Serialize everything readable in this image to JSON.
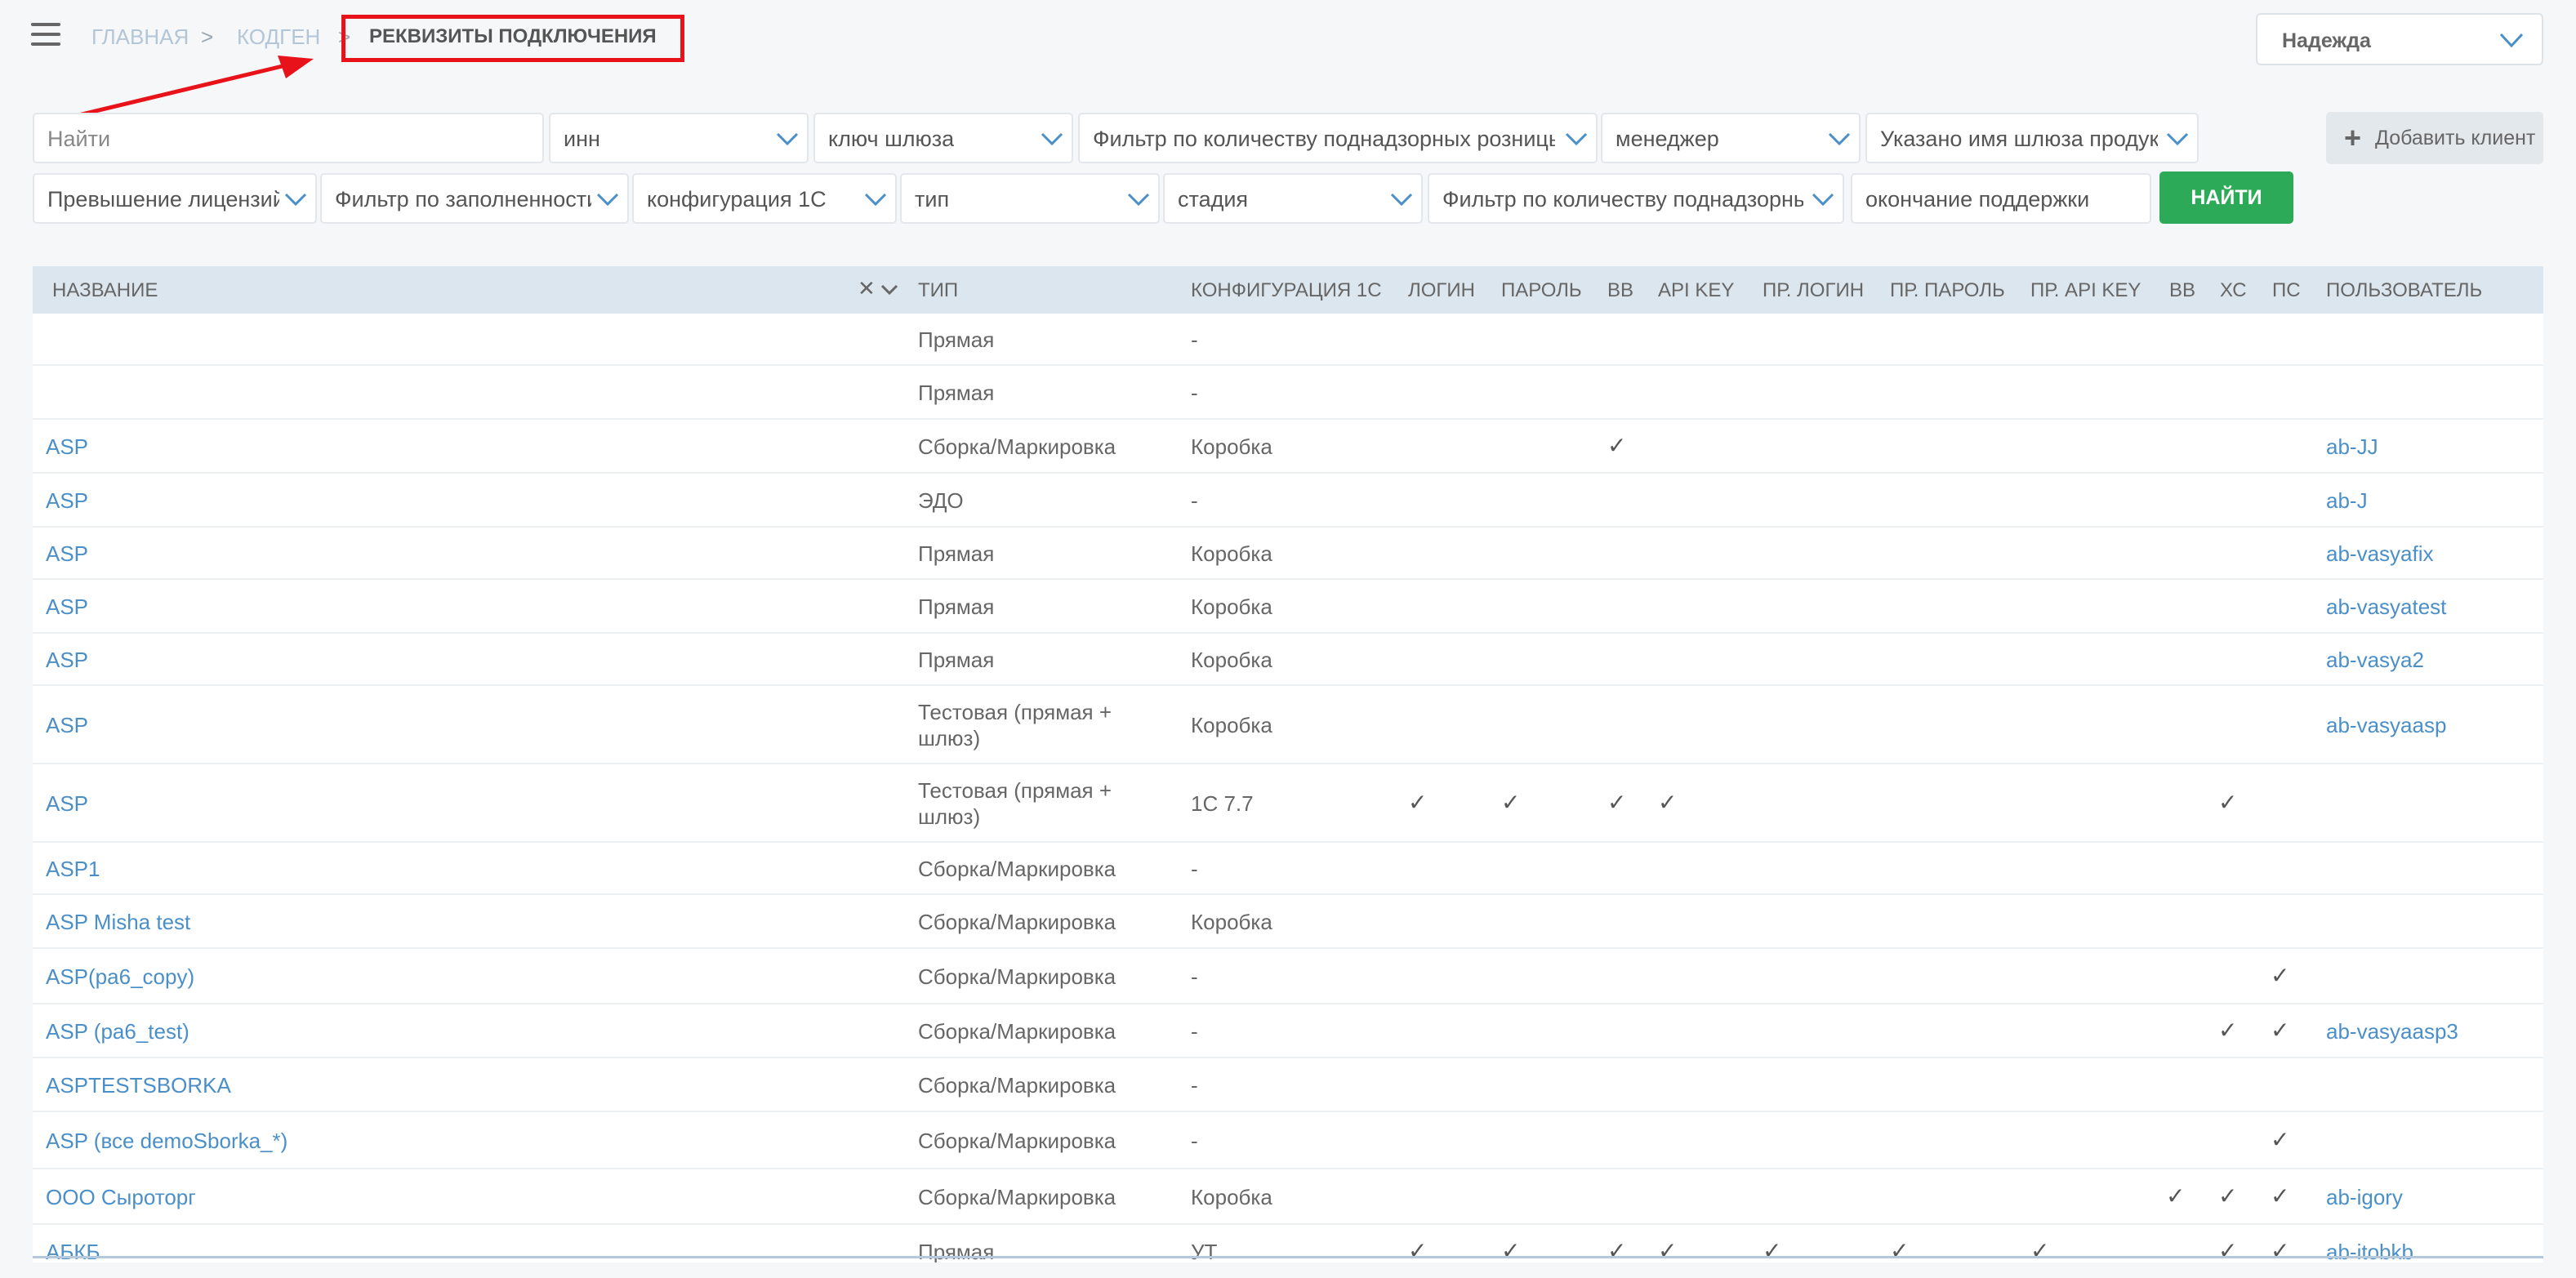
{
  "breadcrumb": {
    "home": "ГЛАВНАЯ",
    "section": "КОДГЕН",
    "current": "РЕКВИЗИТЫ ПОДКЛЮЧЕНИЯ"
  },
  "user": {
    "name": "Надежда"
  },
  "filters": {
    "search_placeholder": "Найти",
    "inn": "инн",
    "gateway_key": "ключ шлюза",
    "retail_filter": "Фильтр по количеству поднадзорных розницы",
    "manager": "менеджер",
    "gateway_product": "Указано имя шлюза продукт",
    "license_excess": "Превышение лицензий",
    "fill_filter": "Фильтр по заполненности",
    "config_1c": "конфигурация 1С",
    "type": "тип",
    "stage": "стадия",
    "supervised_filter": "Фильтр по количеству поднадзорных",
    "support_end_placeholder": "окончание поддержки"
  },
  "buttons": {
    "find": "НАЙТИ",
    "add_client": "Добавить клиент",
    "clear": "✕"
  },
  "table": {
    "headers": [
      "НАЗВАНИЕ",
      "ТИП",
      "КОНФИГУРАЦИЯ 1С",
      "ЛОГИН",
      "ПАРОЛЬ",
      "ВВ",
      "API KEY",
      "ПР. ЛОГИН",
      "ПР. ПАРОЛЬ",
      "ПР. API KEY",
      "ВВ",
      "ХС",
      "ПС",
      "ПОЛЬЗОВАТЕЛЬ"
    ],
    "rows": [
      {
        "name": "",
        "type": "Прямая",
        "config": "-",
        "user": "",
        "checks": []
      },
      {
        "name": "",
        "type": "Прямая",
        "config": "-",
        "user": "",
        "checks": []
      },
      {
        "name": "ASP",
        "type": "Сборка/Маркировка",
        "config": "Коробка",
        "user": "ab-JJ",
        "checks": [
          "bb"
        ]
      },
      {
        "name": "ASP",
        "type": "ЭДО",
        "config": "-",
        "user": "ab-J",
        "checks": []
      },
      {
        "name": "ASP",
        "type": "Прямая",
        "config": "Коробка",
        "user": "ab-vasyafix",
        "checks": []
      },
      {
        "name": "ASP",
        "type": "Прямая",
        "config": "Коробка",
        "user": "ab-vasyatest",
        "checks": []
      },
      {
        "name": "ASP",
        "type": "Прямая",
        "config": "Коробка",
        "user": "ab-vasya2",
        "checks": []
      },
      {
        "name": "ASP",
        "type": "Тестовая (прямая + шлюз)",
        "config": "Коробка",
        "user": "ab-vasyaasp",
        "checks": []
      },
      {
        "name": "ASP",
        "type": "Тестовая (прямая + шлюз)",
        "config": "1С 7.7",
        "user": "",
        "checks": [
          "login",
          "password",
          "bb",
          "api",
          "xs"
        ]
      },
      {
        "name": "ASP1",
        "type": "Сборка/Маркировка",
        "config": "-",
        "user": "",
        "checks": []
      },
      {
        "name": "ASP Misha test",
        "type": "Сборка/Маркировка",
        "config": "Коробка",
        "user": "",
        "checks": []
      },
      {
        "name": "ASP(ра6_copy)",
        "type": "Сборка/Маркировка",
        "config": "-",
        "user": "",
        "checks": [
          "ps"
        ]
      },
      {
        "name": "ASP (ра6_test)",
        "type": "Сборка/Маркировка",
        "config": "-",
        "user": "ab-vasyaasp3",
        "checks": [
          "xs",
          "ps"
        ]
      },
      {
        "name": "ASPTESTSBORKA",
        "type": "Сборка/Маркировка",
        "config": "-",
        "user": "",
        "checks": []
      },
      {
        "name": "ASP (все demoSborka_*)",
        "type": "Сборка/Маркировка",
        "config": "-",
        "user": "",
        "checks": [
          "ps"
        ]
      },
      {
        "name": "ООО Сыроторг",
        "type": "Сборка/Маркировка",
        "config": "Коробка",
        "user": "ab-igory",
        "checks": [
          "bb2",
          "xs",
          "ps"
        ]
      },
      {
        "name": "АБКБ",
        "type": "Прямая",
        "config": "УТ",
        "user": "ab-itobkb",
        "checks": [
          "login",
          "password",
          "bb",
          "api",
          "plogin",
          "ppassword",
          "papi",
          "xs",
          "ps"
        ]
      }
    ],
    "check_glyph": "✓"
  }
}
